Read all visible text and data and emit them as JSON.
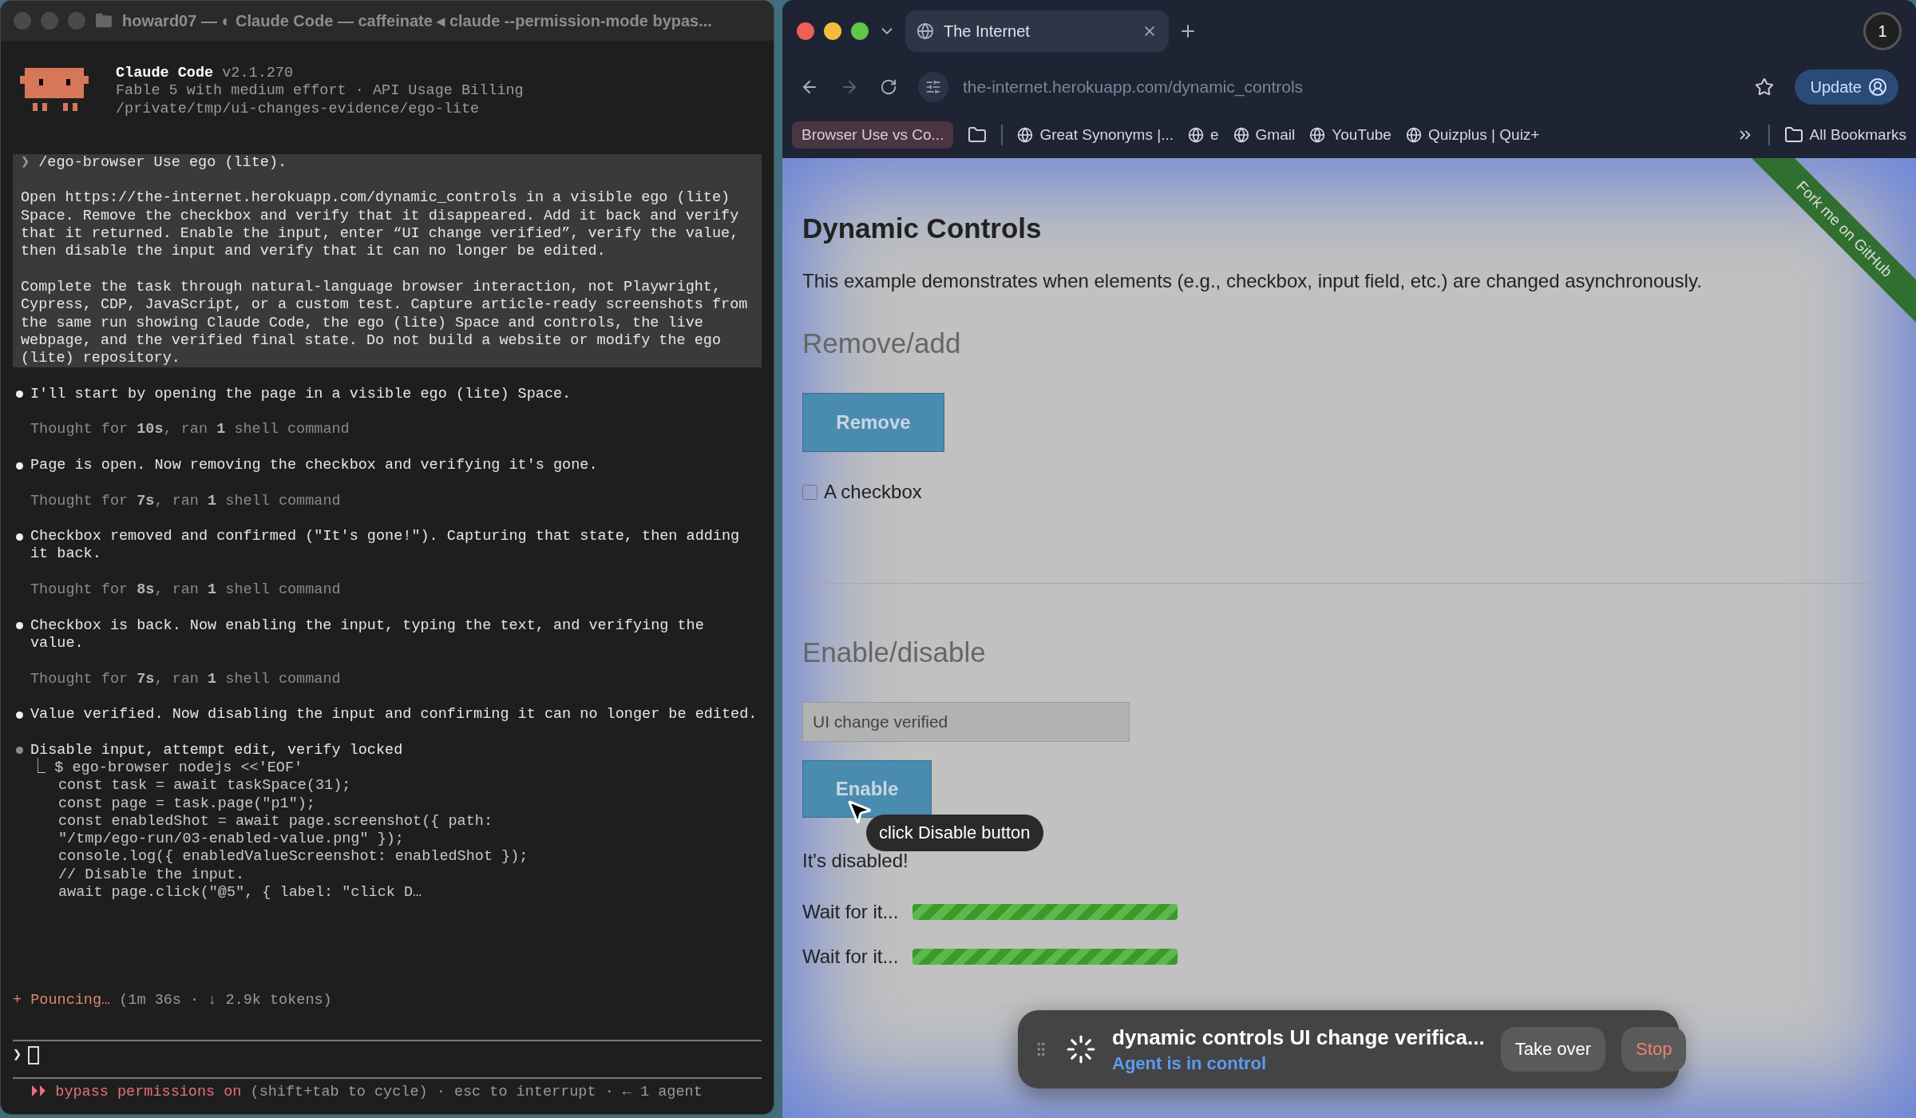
{
  "terminal": {
    "title": "howard07 — ◐ Claude Code — caffeinate ◂ claude --permission-mode bypas...",
    "header": {
      "app": "Claude Code",
      "version": "v2.1.270",
      "lines": [
        "Fable 5 with medium effort · API Usage Billing",
        "/private/tmp/ui-changes-evidence/ego-lite"
      ]
    },
    "prompt": {
      "marker": "❯",
      "command": "/ego-browser Use ego (lite).",
      "paragraphs": [
        [
          "Open https://the-internet.herokuapp.com/dynamic_controls in a visible ego (lite)",
          "Space. Remove the checkbox and verify that it disappeared. Add it back and verify",
          "that it returned. Enable the input, enter “UI change verified”, verify the value,",
          "then disable the input and verify that it can no longer be edited."
        ],
        [
          "Complete the task through natural-language browser interaction, not Playwright,",
          "Cypress, CDP, JavaScript, or a custom test. Capture article-ready screenshots from",
          "the same run showing Claude Code, the ego (lite) Space and controls, the live",
          "webpage, and the verified final state. Do not build a website or modify the ego",
          "(lite) repository."
        ]
      ]
    },
    "messages": [
      {
        "kind": "message",
        "done": true,
        "lines": [
          "I'll start by opening the page in a visible ego (lite) Space."
        ]
      },
      {
        "kind": "thought",
        "text": "Thought for **10s**, ran **1** shell command"
      },
      {
        "kind": "message",
        "done": true,
        "lines": [
          "Page is open. Now removing the checkbox and verifying it's gone."
        ]
      },
      {
        "kind": "thought",
        "text": "Thought for **7s**, ran **1** shell command"
      },
      {
        "kind": "message",
        "done": true,
        "lines": [
          "Checkbox removed and confirmed (\"It's gone!\"). Capturing that state, then adding",
          "it back."
        ]
      },
      {
        "kind": "thought",
        "text": "Thought for **8s**, ran **1** shell command"
      },
      {
        "kind": "message",
        "done": true,
        "lines": [
          "Checkbox is back. Now enabling the input, typing the text, and verifying the",
          "value."
        ]
      },
      {
        "kind": "thought",
        "text": "Thought for **7s**, ran **1** shell command"
      },
      {
        "kind": "message",
        "done": true,
        "lines": [
          "Value verified. Now disabling the input and confirming it can no longer be edited."
        ]
      },
      {
        "kind": "tool",
        "done": false,
        "title": "Disable input, attempt edit, verify locked",
        "connector": "⎿",
        "command": "$ ego-browser nodejs <<'EOF'",
        "code": [
          "const task = await taskSpace(31);",
          "const page = task.page(\"p1\");",
          "const enabledShot = await page.screenshot({ path:",
          "\"/tmp/ego-run/03-enabled-value.png\" });",
          "console.log({ enabledValueScreenshot: enabledShot });",
          "// Disable the input.",
          "await page.click(\"@5\", { label: \"click D…"
        ]
      }
    ],
    "spinner": {
      "glyph": "+",
      "verb": "Pouncing…",
      "detail": "(1m 36s · ↓ 2.9k tokens)"
    },
    "input": {
      "marker": "❯"
    },
    "status": {
      "glyph": "⏵⏵",
      "mode": "bypass permissions on",
      "hints": "(shift+tab to cycle) · esc to interrupt · ← 1 agent"
    }
  },
  "browser": {
    "tabs": [
      {
        "title": "The Internet",
        "selected": true
      }
    ],
    "profile_badge": "1",
    "url": "the-internet.herokuapp.com/dynamic_controls",
    "update_label": "Update",
    "bookmarks": {
      "pinned": "Browser Use vs Co...",
      "sites": [
        "Great Synonyms |...",
        "e",
        "Gmail",
        "YouTube",
        "Quizplus | Quiz+"
      ],
      "all_bookmarks": "All Bookmarks"
    },
    "page": {
      "title": "Dynamic Controls",
      "description": "This example demonstrates when elements (e.g., checkbox, input field, etc.) are changed asynchronously.",
      "ribbon": "Fork me on GitHub",
      "remove_add": {
        "heading": "Remove/add",
        "button": "Remove",
        "checkbox": {
          "label": "A checkbox",
          "checked": false
        }
      },
      "enable_disable": {
        "heading": "Enable/disable",
        "input": {
          "value": "UI change verified",
          "disabled": true
        },
        "button": "Enable",
        "message": "It's disabled!",
        "loaders": [
          {
            "label": "Wait for it...",
            "level": 1
          },
          {
            "label": "Wait for it...",
            "level": 1
          }
        ]
      }
    },
    "tooltip": "click Disable button",
    "agent_panel": {
      "task": "dynamic controls UI change verifica...",
      "status": "Agent is in control",
      "take_over": "Take over",
      "stop": "Stop"
    }
  }
}
